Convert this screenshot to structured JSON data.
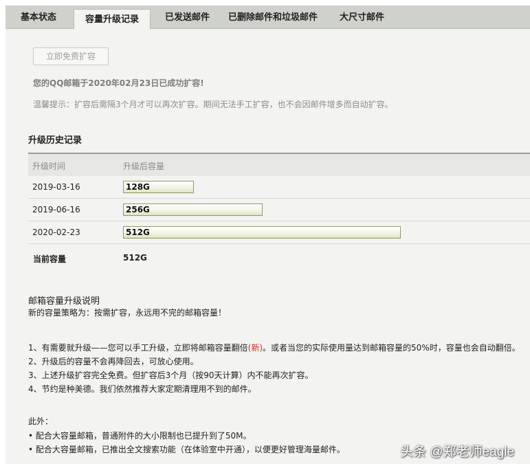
{
  "tabs": [
    {
      "label": "基本状态"
    },
    {
      "label": "容量升级记录"
    },
    {
      "label": "已发送邮件"
    },
    {
      "label": "已删除邮件和垃圾邮件"
    },
    {
      "label": "大尺寸邮件"
    }
  ],
  "upgrade_button": "立即免费扩容",
  "success_message": "您的QQ邮箱于2020年02月23日已成功扩容!",
  "tip_message": "温馨提示：扩容后需隔3个月才可以再次扩容。期间无法手工扩容，也不会因邮件增多而自动扩容。",
  "history": {
    "title": "升级历史记录",
    "columns": [
      "升级时间",
      "升级后容量"
    ],
    "rows": [
      {
        "date": "2019-03-16",
        "capacity": "128G",
        "fraction": 0.25
      },
      {
        "date": "2019-06-16",
        "capacity": "256G",
        "fraction": 0.5
      },
      {
        "date": "2020-02-23",
        "capacity": "512G",
        "fraction": 1.0
      }
    ]
  },
  "current": {
    "label": "当前容量",
    "value": "512G"
  },
  "explanation": {
    "title": "邮箱容量升级说明",
    "strategy": "新的容量策略为：按需扩容，永远用不完的邮箱容量！",
    "item1_before": "1、有需要就升级——您可以手工升级，立即将邮箱容量翻倍",
    "item1_new": "(新)",
    "item1_after": "。或者当您的实际使用量达到邮箱容量的50%时，容量也会自动翻倍。",
    "item2": "2、升级后的容量不会再降回去，可放心使用。",
    "item3": "3、上述升级扩容完全免费。但扩容后3个月（按90天计算）内不能再次扩容。",
    "item4": "4、节约是种美德。我们依然推荐大家定期清理用不到的邮件。",
    "besides_label": "此外：",
    "bullet1": "• 配合大容量邮箱，普通附件的大小限制也已提升到了50M。",
    "bullet2": "• 配合大容量邮箱，已推出全文搜索功能（在体验室中开通），以便更好管理海量邮件。"
  },
  "watermark": "头条 @郑老师eagle"
}
